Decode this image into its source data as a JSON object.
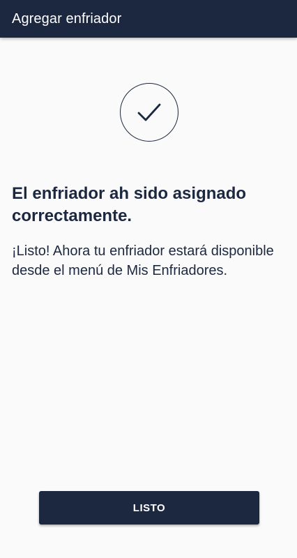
{
  "app_bar": {
    "title": "Agregar enfriador",
    "background_color": "#1c2740"
  },
  "status": {
    "icon": "checkmark-icon",
    "headline": "El enfriador ah sido asignado correctamente.",
    "message": "¡Listo! Ahora tu enfriador estará disponible desde el menú de Mis Enfriadores."
  },
  "actions": {
    "done_label": "LISTO"
  },
  "colors": {
    "primary": "#1c2740",
    "background": "#fafafa",
    "on_primary": "#ffffff"
  }
}
